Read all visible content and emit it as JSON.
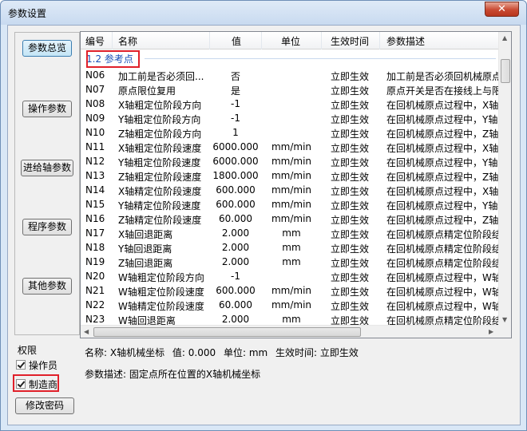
{
  "window": {
    "title": "参数设置",
    "close": "✕"
  },
  "nav": [
    "参数总览",
    "操作参数",
    "进给轴参数",
    "程序参数",
    "其他参数"
  ],
  "permissions": {
    "title": "权限",
    "operator": "操作员",
    "manufacturer": "制造商",
    "change_password": "修改密码"
  },
  "columns": [
    "编号",
    "名称",
    "值",
    "单位",
    "生效时间",
    "参数描述"
  ],
  "section_label": "1.2 参考点",
  "rows": [
    {
      "id": "N06",
      "name": "加工前是否必须回...",
      "value": "否",
      "unit": "",
      "effect": "立即生效",
      "desc": "加工前是否必须回机械原点后才"
    },
    {
      "id": "N07",
      "name": "原点限位复用",
      "value": "是",
      "unit": "",
      "effect": "立即生效",
      "desc": "原点开关是否在接线上与限位开"
    },
    {
      "id": "N08",
      "name": "X轴粗定位阶段方向",
      "value": "-1",
      "unit": "",
      "effect": "立即生效",
      "desc": "在回机械原点过程中，X轴粗定位"
    },
    {
      "id": "N09",
      "name": "Y轴粗定位阶段方向",
      "value": "-1",
      "unit": "",
      "effect": "立即生效",
      "desc": "在回机械原点过程中，Y轴粗定位"
    },
    {
      "id": "N10",
      "name": "Z轴粗定位阶段方向",
      "value": "1",
      "unit": "",
      "effect": "立即生效",
      "desc": "在回机械原点过程中，Z轴粗定位"
    },
    {
      "id": "N11",
      "name": "X轴粗定位阶段速度",
      "value": "6000.000",
      "unit": "mm/min",
      "effect": "立即生效",
      "desc": "在回机械原点过程中，X轴粗定位"
    },
    {
      "id": "N12",
      "name": "Y轴粗定位阶段速度",
      "value": "6000.000",
      "unit": "mm/min",
      "effect": "立即生效",
      "desc": "在回机械原点过程中，Y轴粗定位"
    },
    {
      "id": "N13",
      "name": "Z轴粗定位阶段速度",
      "value": "1800.000",
      "unit": "mm/min",
      "effect": "立即生效",
      "desc": "在回机械原点过程中，Z轴粗定位"
    },
    {
      "id": "N14",
      "name": "X轴精定位阶段速度",
      "value": "600.000",
      "unit": "mm/min",
      "effect": "立即生效",
      "desc": "在回机械原点过程中，X轴精定位"
    },
    {
      "id": "N15",
      "name": "Y轴精定位阶段速度",
      "value": "600.000",
      "unit": "mm/min",
      "effect": "立即生效",
      "desc": "在回机械原点过程中，Y轴精定位"
    },
    {
      "id": "N16",
      "name": "Z轴精定位阶段速度",
      "value": "60.000",
      "unit": "mm/min",
      "effect": "立即生效",
      "desc": "在回机械原点过程中，Z轴精定位"
    },
    {
      "id": "N17",
      "name": "X轴回退距离",
      "value": "2.000",
      "unit": "mm",
      "effect": "立即生效",
      "desc": "在回机械原点精定位阶段结束后"
    },
    {
      "id": "N18",
      "name": "Y轴回退距离",
      "value": "2.000",
      "unit": "mm",
      "effect": "立即生效",
      "desc": "在回机械原点精定位阶段结束后"
    },
    {
      "id": "N19",
      "name": "Z轴回退距离",
      "value": "2.000",
      "unit": "mm",
      "effect": "立即生效",
      "desc": "在回机械原点精定位阶段结束后"
    },
    {
      "id": "N20",
      "name": "W轴粗定位阶段方向",
      "value": "-1",
      "unit": "",
      "effect": "立即生效",
      "desc": "在回机械原点过程中，W轴粗定位"
    },
    {
      "id": "N21",
      "name": "W轴粗定位阶段速度",
      "value": "600.000",
      "unit": "mm/min",
      "effect": "立即生效",
      "desc": "在回机械原点过程中，W轴粗定位"
    },
    {
      "id": "N22",
      "name": "W轴精定位阶段速度",
      "value": "60.000",
      "unit": "mm/min",
      "effect": "立即生效",
      "desc": "在回机械原点过程中，W轴精定位"
    },
    {
      "id": "N23",
      "name": "W轴回退距离",
      "value": "2.000",
      "unit": "mm",
      "effect": "立即生效",
      "desc": "在回机械原点精定位阶段结束后"
    }
  ],
  "detail": {
    "name_label": "名称: X轴机械坐标",
    "value_label": "值: 0.000",
    "unit_label": "单位: mm",
    "effect_label": "生效时间: 立即生效",
    "description": "参数描述: 固定点所在位置的X轴机械坐标"
  }
}
